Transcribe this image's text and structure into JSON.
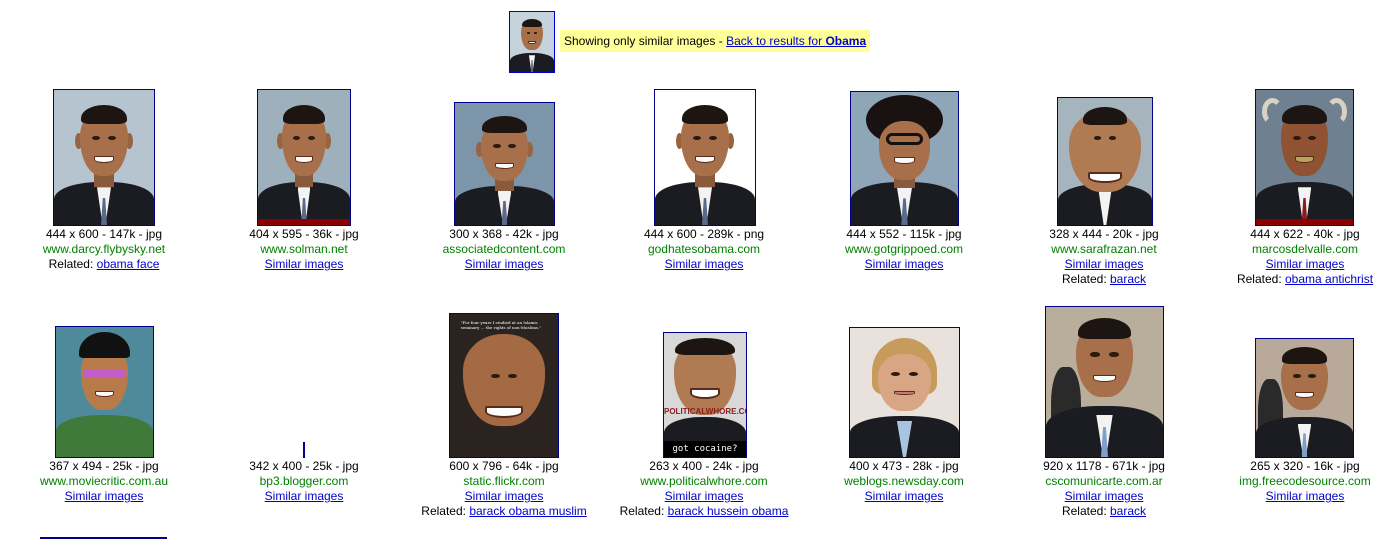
{
  "notice": {
    "text": "Showing only similar images - ",
    "link_prefix": "Back to results for ",
    "link_query": "Obama"
  },
  "results": [
    {
      "dims": "444 x 600 - 147k - jpg",
      "site": "www.darcy.flybysky.net",
      "related_label": "Related:",
      "related_link": "obama face"
    },
    {
      "dims": "404 x 595 - 36k - jpg",
      "site": "www.solman.net",
      "similar": "Similar images"
    },
    {
      "dims": "300 x 368 - 42k - jpg",
      "site": "associatedcontent.com",
      "similar": "Similar images"
    },
    {
      "dims": "444 x 600 - 289k - png",
      "site": "godhatesobama.com",
      "similar": "Similar images"
    },
    {
      "dims": "444 x 552 - 115k - jpg",
      "site": "www.gotgrippoed.com",
      "similar": "Similar images"
    },
    {
      "dims": "328 x 444 - 20k - jpg",
      "site": "www.sarafrazan.net",
      "similar": "Similar images",
      "related_label": "Related:",
      "related_link": "barack"
    },
    {
      "dims": "444 x 622 - 40k - jpg",
      "site": "marcosdelvalle.com",
      "similar": "Similar images",
      "related_label": "Related:",
      "related_link": "obama antichrist"
    },
    {
      "dims": "367 x 494 - 25k - jpg",
      "site": "www.moviecritic.com.au",
      "similar": "Similar images"
    },
    {
      "dims": "342 x 400 - 25k - jpg",
      "site": "bp3.blogger.com",
      "similar": "Similar images"
    },
    {
      "dims": "600 x 796 - 64k - jpg",
      "site": "static.flickr.com",
      "similar": "Similar images",
      "related_label": "Related:",
      "related_link": "barack obama muslim"
    },
    {
      "dims": "263 x 400 - 24k - jpg",
      "site": "www.politicalwhore.com",
      "similar": "Similar images",
      "related_label": "Related:",
      "related_link": "barack hussein obama"
    },
    {
      "dims": "400 x 473 - 28k - jpg",
      "site": "weblogs.newsday.com",
      "similar": "Similar images"
    },
    {
      "dims": "920 x 1178 - 671k - jpg",
      "site": "cscomunicarte.com.ar",
      "similar": "Similar images",
      "related_label": "Related:",
      "related_link": "barack"
    },
    {
      "dims": "265 x 320 - 16k - jpg",
      "site": "img.freecodesource.com",
      "similar": "Similar images"
    }
  ],
  "thumb_text": {
    "flickr_caption": "\"For four years I studied at an Islamic seminary ... the rights of non-Muslims.\"",
    "politicalwhore_watermark": "POLITICALWHORE.COM",
    "got_cocaine": "got cocaine?"
  },
  "colors": {
    "link": "#0000cc",
    "site_url": "#008000",
    "notice_bg": "#ffff99",
    "thumb_border": "#00008b"
  }
}
